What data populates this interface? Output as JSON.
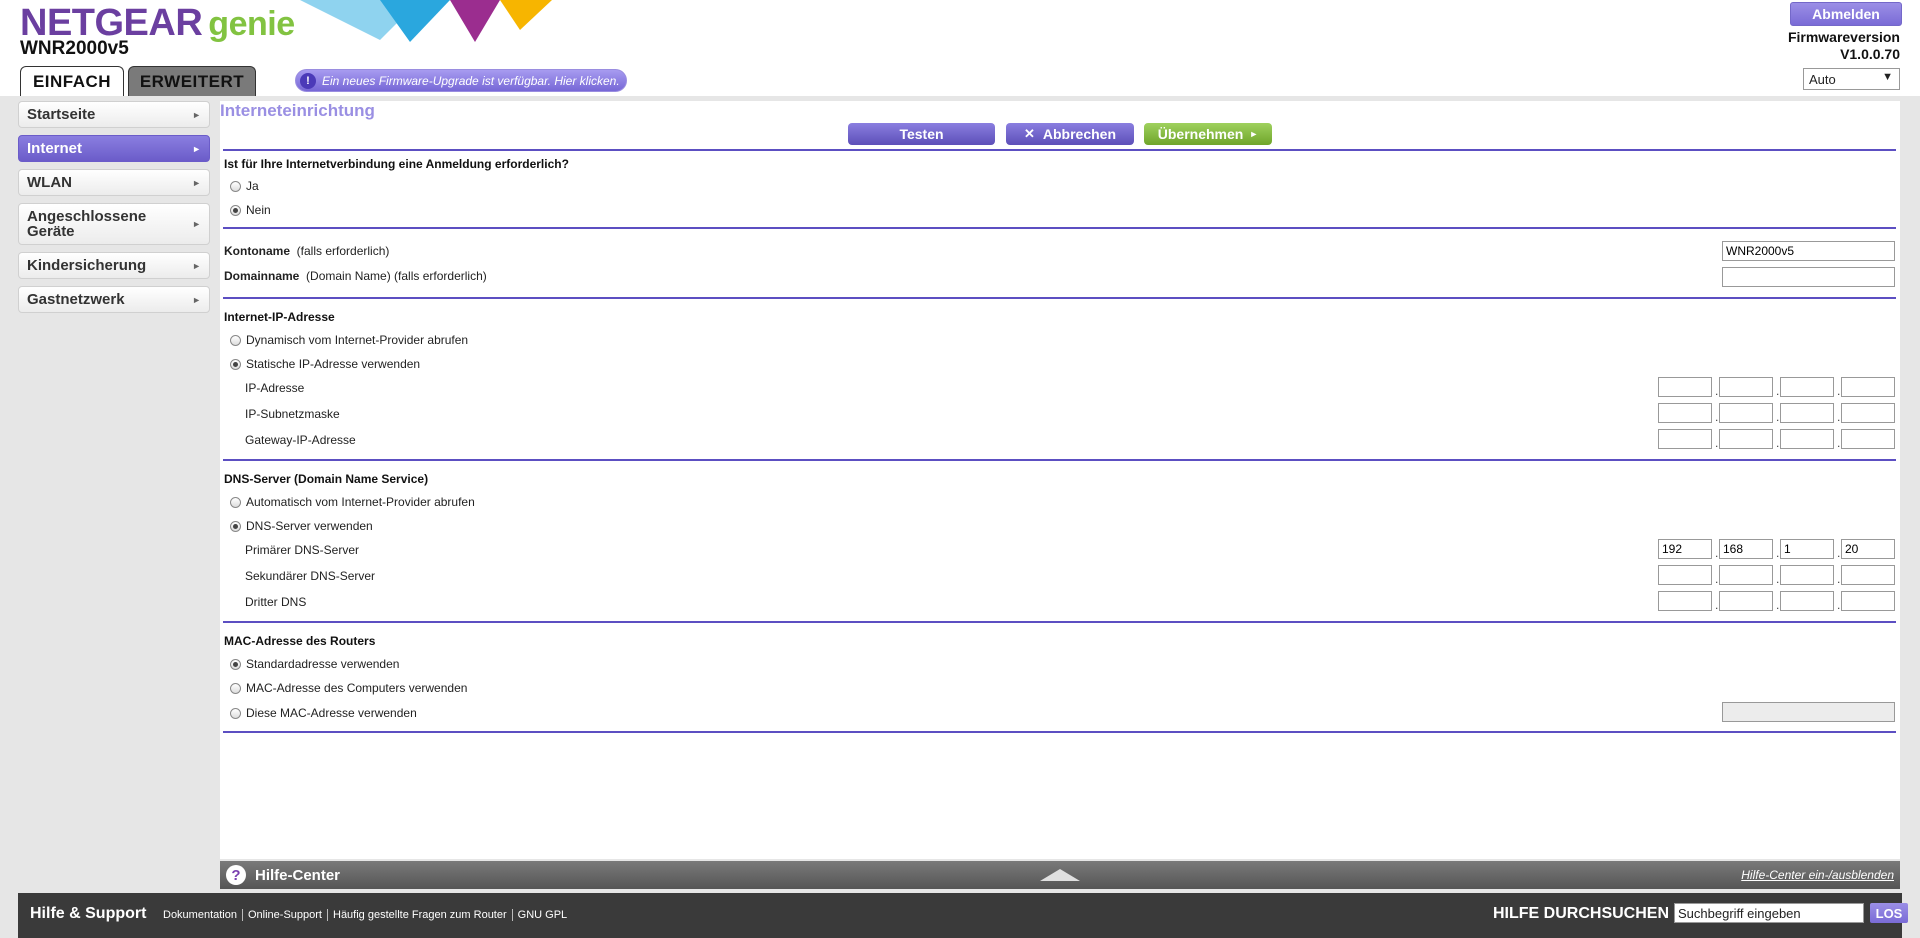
{
  "header": {
    "brand": "NETGEAR",
    "brand_suffix": "genie",
    "model": "WNR2000v5",
    "logout_label": "Abmelden",
    "firmware_label": "Firmwareversion",
    "firmware_version": "V1.0.0.70",
    "language": "Auto",
    "firmware_notice": "Ein neues Firmware-Upgrade ist verfügbar. Hier klicken.",
    "notice_icon": "!",
    "tabs": [
      {
        "label": "EINFACH",
        "active": true
      },
      {
        "label": "ERWEITERT",
        "active": false
      }
    ]
  },
  "sidebar": {
    "items": [
      {
        "label": "Startseite",
        "active": false
      },
      {
        "label": "Internet",
        "active": true
      },
      {
        "label": "WLAN",
        "active": false
      },
      {
        "label": "Angeschlossene Geräte",
        "active": false
      },
      {
        "label": "Kindersicherung",
        "active": false
      },
      {
        "label": "Gastnetzwerk",
        "active": false
      }
    ],
    "chevron": "►"
  },
  "main": {
    "title": "Interneteinrichtung",
    "buttons": {
      "test": "Testen",
      "cancel": "Abbrechen",
      "apply": "Übernehmen"
    },
    "login_section": {
      "question": "Ist für Ihre Internetverbindung eine Anmeldung erforderlich?",
      "options": [
        "Ja",
        "Nein"
      ],
      "selected": "Nein"
    },
    "account": {
      "account_label": "Kontoname",
      "account_hint": "(falls erforderlich)",
      "account_value": "WNR2000v5",
      "domain_label": "Domainname",
      "domain_hint": "(Domain Name) (falls erforderlich)",
      "domain_value": ""
    },
    "ip_section": {
      "title": "Internet-IP-Adresse",
      "options": [
        "Dynamisch vom Internet-Provider abrufen",
        "Statische IP-Adresse verwenden"
      ],
      "selected": "Statische IP-Adresse verwenden",
      "fields": [
        {
          "label": "IP-Adresse",
          "octets": [
            "",
            "",
            "",
            ""
          ]
        },
        {
          "label": "IP-Subnetzmaske",
          "octets": [
            "",
            "",
            "",
            ""
          ]
        },
        {
          "label": "Gateway-IP-Adresse",
          "octets": [
            "",
            "",
            "",
            ""
          ]
        }
      ]
    },
    "dns_section": {
      "title": "DNS-Server (Domain Name Service)",
      "options": [
        "Automatisch vom Internet-Provider abrufen",
        "DNS-Server verwenden"
      ],
      "selected": "DNS-Server verwenden",
      "fields": [
        {
          "label": "Primärer DNS-Server",
          "octets": [
            "192",
            "168",
            "1",
            "20"
          ]
        },
        {
          "label": "Sekundärer DNS-Server",
          "octets": [
            "",
            "",
            "",
            ""
          ]
        },
        {
          "label": "Dritter DNS",
          "octets": [
            "",
            "",
            "",
            ""
          ]
        }
      ]
    },
    "mac_section": {
      "title": "MAC-Adresse des Routers",
      "options": [
        "Standardadresse verwenden",
        "MAC-Adresse des Computers verwenden",
        "Diese MAC-Adresse verwenden"
      ],
      "selected": "Standardadresse verwenden",
      "custom_mac_value": ""
    }
  },
  "help_bar": {
    "icon": "?",
    "title": "Hilfe-Center",
    "toggle_label": "Hilfe-Center ein-/ausblenden"
  },
  "footer": {
    "title": "Hilfe & Support",
    "links": [
      "Dokumentation",
      "Online-Support",
      "Häufig gestellte Fragen zum Router",
      "GNU GPL"
    ],
    "search_title": "HILFE DURCHSUCHEN",
    "search_value": "Suchbegriff eingeben",
    "search_button": "LOS"
  },
  "colors": {
    "accent_purple": "#6b5cc9",
    "apply_green": "#82c341",
    "title_lilac": "#9a8fe3"
  }
}
